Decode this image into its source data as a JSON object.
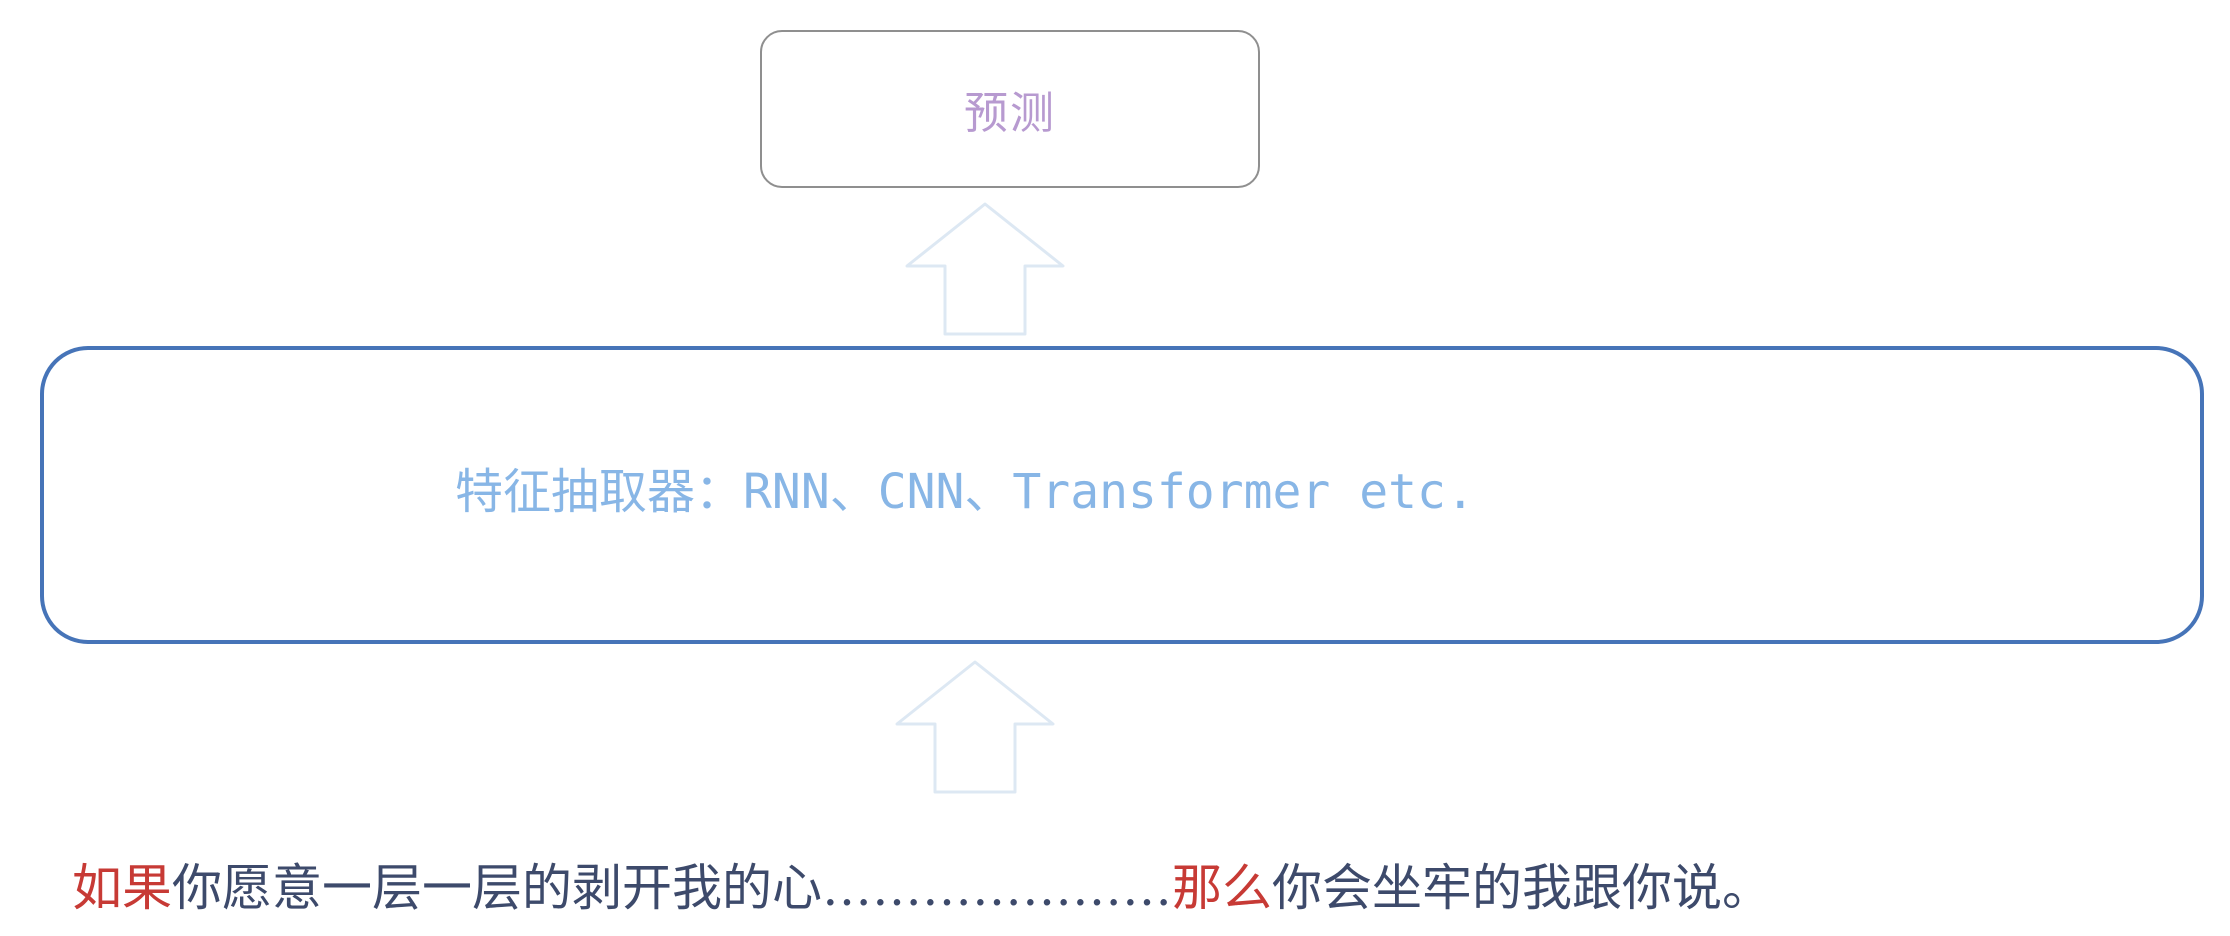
{
  "diagram": {
    "top_box": {
      "label": "预测"
    },
    "middle_box": {
      "label_prefix": "特征抽取器：",
      "label_models": "RNN、CNN、Transformer etc."
    },
    "input_sentence": {
      "part1_highlight": "如果",
      "part2": "你愿意一层一层的剥开我的心",
      "part3_dots": "…………………",
      "part4_highlight": "那么",
      "part5": "你会坐牢的我跟你说。"
    },
    "colors": {
      "top_box_border": "#8f8f8f",
      "top_box_text": "#b79ad0",
      "middle_box_border": "#4674b8",
      "middle_box_text": "#88b6e6",
      "arrow_outline": "#dde8f3",
      "sentence_text": "#3d4a6b",
      "sentence_highlight": "#c73a35"
    },
    "arrows": [
      {
        "direction": "up",
        "from": "middle_box",
        "to": "top_box"
      },
      {
        "direction": "up",
        "from": "input_sentence",
        "to": "middle_box"
      }
    ]
  }
}
